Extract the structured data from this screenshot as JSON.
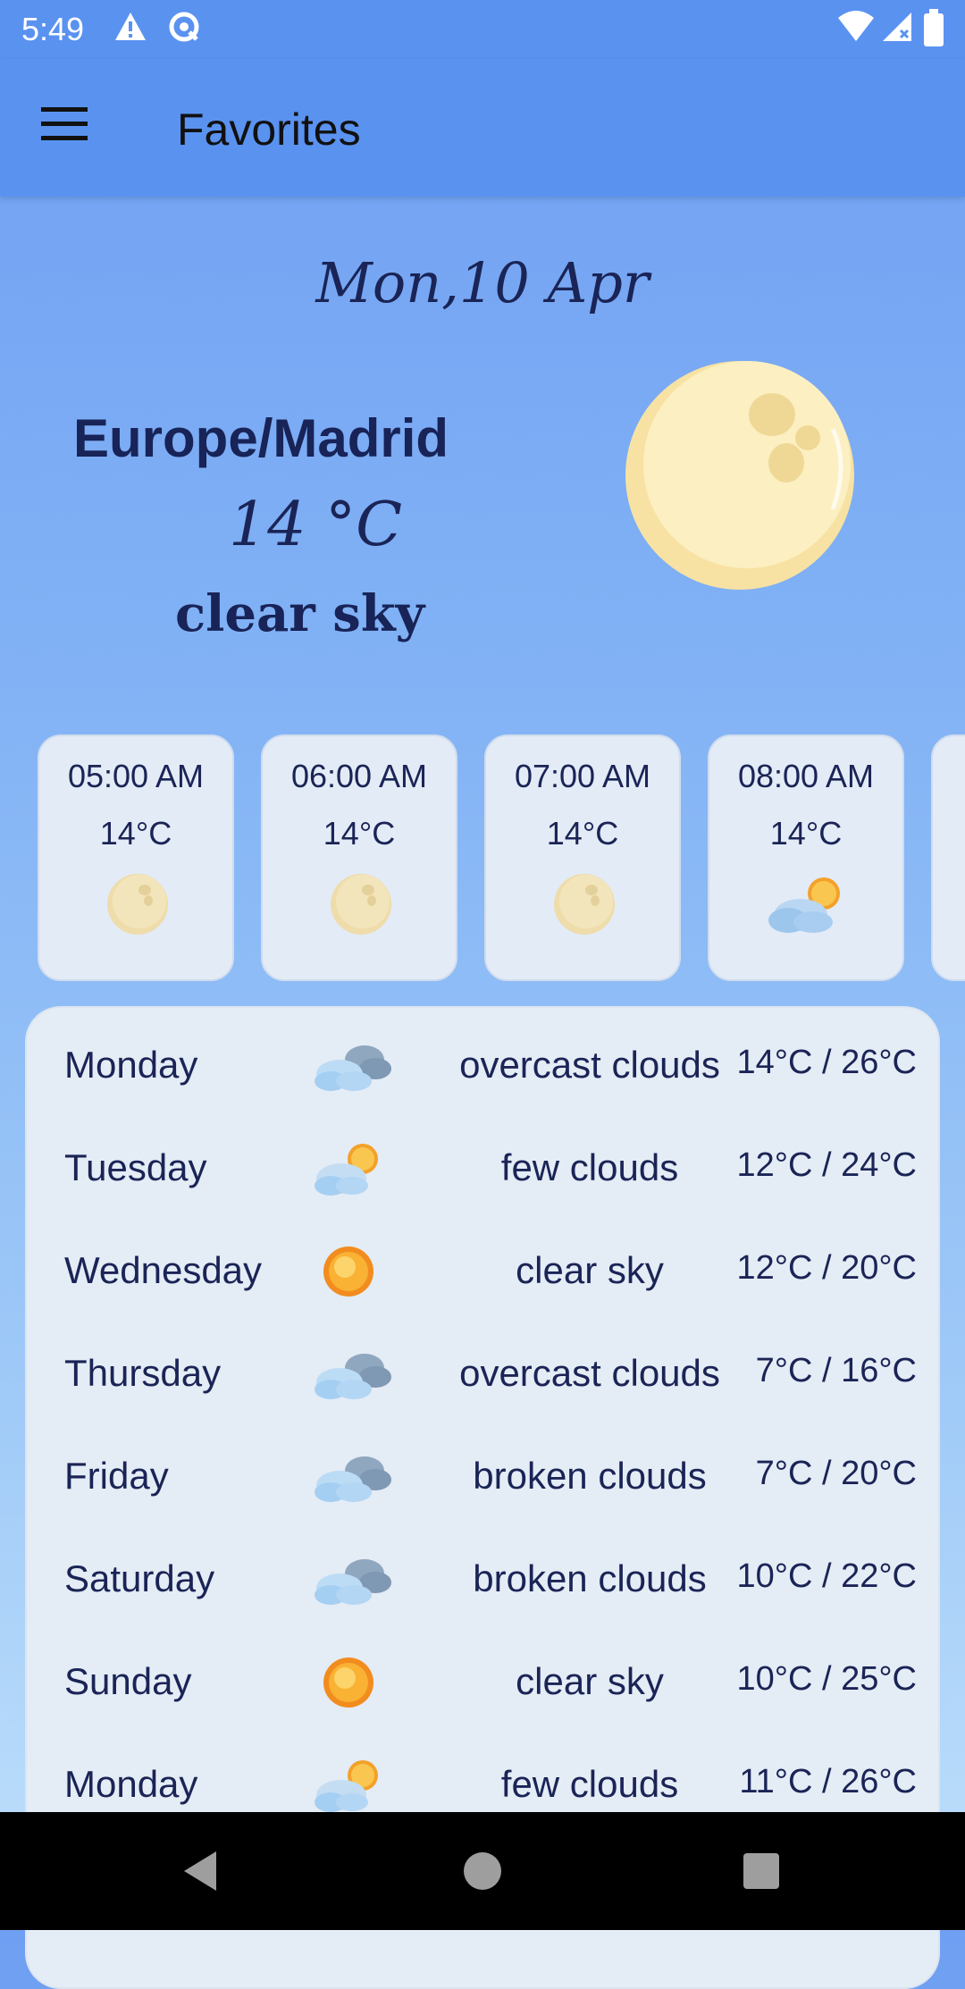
{
  "status": {
    "time": "5:49"
  },
  "app_bar": {
    "title": "Favorites"
  },
  "current": {
    "date": "Mon,10 Apr",
    "city": "Europe/Madrid",
    "temp": "14 °C",
    "description": "clear sky",
    "icon": "moon-icon"
  },
  "hourly": [
    {
      "time": "05:00 AM",
      "temp": "14°C",
      "icon": "moon-icon"
    },
    {
      "time": "06:00 AM",
      "temp": "14°C",
      "icon": "moon-icon"
    },
    {
      "time": "07:00 AM",
      "temp": "14°C",
      "icon": "moon-icon"
    },
    {
      "time": "08:00 AM",
      "temp": "14°C",
      "icon": "partly-cloudy-icon"
    }
  ],
  "daily": [
    {
      "day": "Monday",
      "desc": "overcast clouds",
      "range": "14°C / 26°C",
      "icon": "clouds-icon"
    },
    {
      "day": "Tuesday",
      "desc": "few clouds",
      "range": "12°C / 24°C",
      "icon": "partly-cloudy-icon"
    },
    {
      "day": "Wednesday",
      "desc": "clear sky",
      "range": "12°C / 20°C",
      "icon": "sun-icon"
    },
    {
      "day": "Thursday",
      "desc": "overcast clouds",
      "range": "7°C / 16°C",
      "icon": "clouds-icon"
    },
    {
      "day": "Friday",
      "desc": "broken clouds",
      "range": "7°C / 20°C",
      "icon": "clouds-icon"
    },
    {
      "day": "Saturday",
      "desc": "broken clouds",
      "range": "10°C / 22°C",
      "icon": "clouds-icon"
    },
    {
      "day": "Sunday",
      "desc": "clear sky",
      "range": "10°C / 25°C",
      "icon": "sun-icon"
    },
    {
      "day": "Monday",
      "desc": "few clouds",
      "range": "11°C / 26°C",
      "icon": "partly-cloudy-icon"
    }
  ]
}
